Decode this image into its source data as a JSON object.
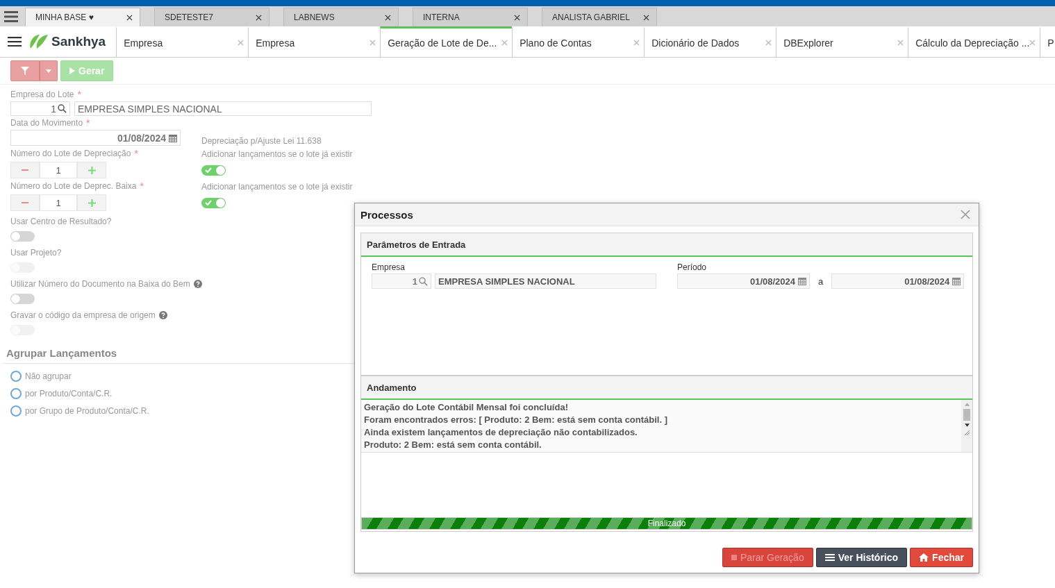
{
  "browser_tabs": [
    {
      "label": "MINHA BASE ♥",
      "selected": true
    },
    {
      "label": "SDETESTE7",
      "selected": false
    },
    {
      "label": "LABNEWS",
      "selected": false
    },
    {
      "label": "INTERNA",
      "selected": false
    },
    {
      "label": "ANALISTA GABRIEL",
      "selected": false
    }
  ],
  "brand": "Sankhya",
  "app_tabs": [
    {
      "label": "Empresa",
      "selected": false
    },
    {
      "label": "Empresa",
      "selected": false
    },
    {
      "label": "Geração de Lote de De...",
      "selected": true
    },
    {
      "label": "Plano de Contas",
      "selected": false
    },
    {
      "label": "Dicionário de Dados",
      "selected": false
    },
    {
      "label": "DBExplorer",
      "selected": false
    },
    {
      "label": "Cálculo da Depreciação ...",
      "selected": false
    },
    {
      "label": "P",
      "selected": false
    }
  ],
  "toolbar": {
    "run_button": {
      "label": "Gerar",
      "disabled": true
    }
  },
  "form": {
    "empresa": {
      "label": "Empresa do Lote",
      "required_mark": "*",
      "code": "1",
      "name": "EMPRESA SIMPLES NACIONAL"
    },
    "data": {
      "label": "Data do Movimento",
      "required_mark": "*",
      "value": "01/08/2024"
    },
    "ajuste_label": "Depreciação p/Ajuste Lei 11.638",
    "lotes": [
      {
        "label": "Número do Lote de Depreciação",
        "required_mark": "*",
        "value": "1",
        "toggle_label": "Adicionar lançamentos se o lote já existir",
        "toggle_on": true
      },
      {
        "label": "Número do Lote de Deprec. Baixa",
        "required_mark": "*",
        "value": "1",
        "toggle_label": "Adicionar lançamentos se o lote já existir",
        "toggle_on": true
      }
    ],
    "switches": [
      {
        "kind": "plain",
        "label": "Usar Centro de Resultado?",
        "on": false,
        "disabled": false
      },
      {
        "kind": "plain",
        "label": "Usar Projeto?",
        "on": false,
        "disabled": true
      },
      {
        "kind": "help",
        "label": "Utilizar Número do Documento na Baixa do Bem",
        "on": false,
        "disabled": false
      },
      {
        "kind": "help",
        "label": "Gravar o código da empresa de origem",
        "on": false,
        "disabled": true
      }
    ],
    "group_title": "Agrupar Lançamentos",
    "group_options": [
      {
        "label": "Não agrupar",
        "selected": false
      },
      {
        "label": "por Produto/Conta/C.R.",
        "selected": false
      },
      {
        "label": "por Grupo de Produto/Conta/C.R.",
        "selected": false
      }
    ]
  },
  "dialog": {
    "title": "Processos",
    "params": {
      "title": "Parâmetros de Entrada",
      "empresa_label": "Empresa",
      "empresa_code": "1",
      "empresa_name": "EMPRESA SIMPLES NACIONAL",
      "periodo_label": "Período",
      "from": "01/08/2024",
      "sep": "a",
      "to": "01/08/2024"
    },
    "progress": {
      "title": "Andamento",
      "log": [
        "Geração do Lote Contábil Mensal foi concluída!",
        "Foram encontrados erros: [ Produto: 2 Bem:  está sem conta contábil. ]",
        "Ainda existem lançamentos de depreciação não contabilizados.",
        "Produto: 2 Bem:  está sem conta contábil."
      ],
      "level": 1,
      "status": "Finalizado"
    },
    "buttons": [
      {
        "kind": "stop",
        "label": "Parar Geração",
        "disabled": true
      },
      {
        "kind": "history",
        "label": "Ver Histórico",
        "disabled": false
      },
      {
        "kind": "close",
        "label": "Fechar",
        "disabled": false
      }
    ]
  }
}
